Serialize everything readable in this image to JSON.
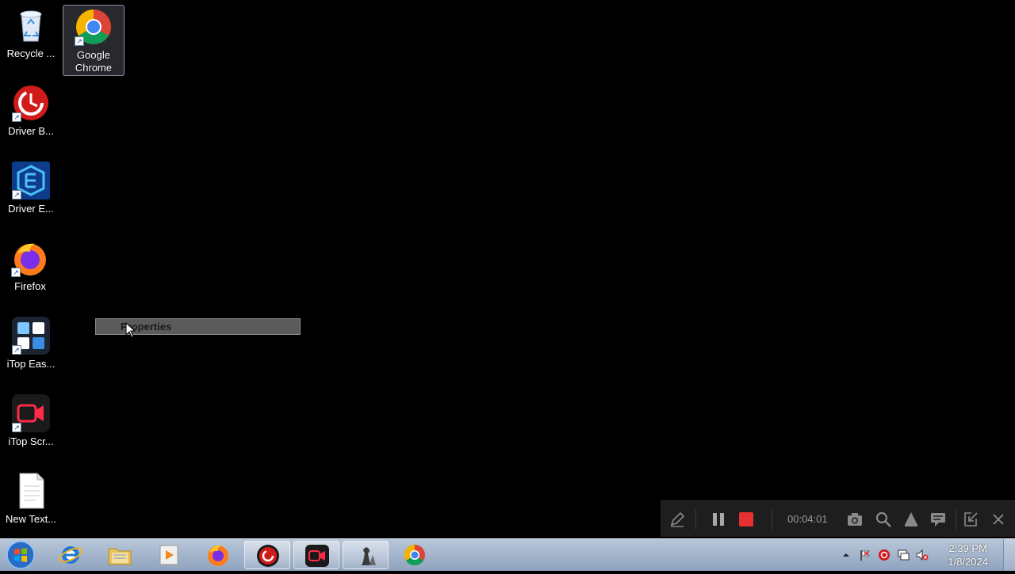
{
  "desktop": {
    "icons": [
      {
        "label": "Recycle ...",
        "icon": "recycle-bin-icon"
      },
      {
        "label": "Google Chrome",
        "icon": "chrome-icon"
      },
      {
        "label": "Driver B...",
        "icon": "driver-booster-icon"
      },
      {
        "label": "Driver E...",
        "icon": "driver-easy-icon"
      },
      {
        "label": "Firefox",
        "icon": "firefox-icon"
      },
      {
        "label": "iTop Eas...",
        "icon": "itop-easy-desktop-icon"
      },
      {
        "label": "iTop Scr...",
        "icon": "itop-screen-recorder-icon"
      },
      {
        "label": "New Text...",
        "icon": "text-document-icon"
      }
    ]
  },
  "context_menu": {
    "item": "Properties"
  },
  "recorder": {
    "time": "00:04:01",
    "buttons": [
      "pen-icon",
      "pause-icon",
      "stop-icon",
      "camera-icon",
      "zoom-icon",
      "volume-icon",
      "chat-icon",
      "minimize-icon",
      "close-icon"
    ],
    "stop_color": "#e83030"
  },
  "taskbar": {
    "start": "windows-start-icon",
    "pinned": [
      "internet-explorer-icon",
      "file-explorer-icon",
      "media-player-icon",
      "firefox-icon",
      "driver-booster-icon",
      "itop-screen-recorder-icon",
      "chess-icon",
      "chrome-icon"
    ],
    "tray": [
      "show-hidden-icons-icon",
      "action-center-flag-icon",
      "driver-booster-tray-icon",
      "network-icon",
      "volume-muted-icon"
    ],
    "clock": {
      "time": "2:39 PM",
      "date": "1/8/2024"
    }
  }
}
